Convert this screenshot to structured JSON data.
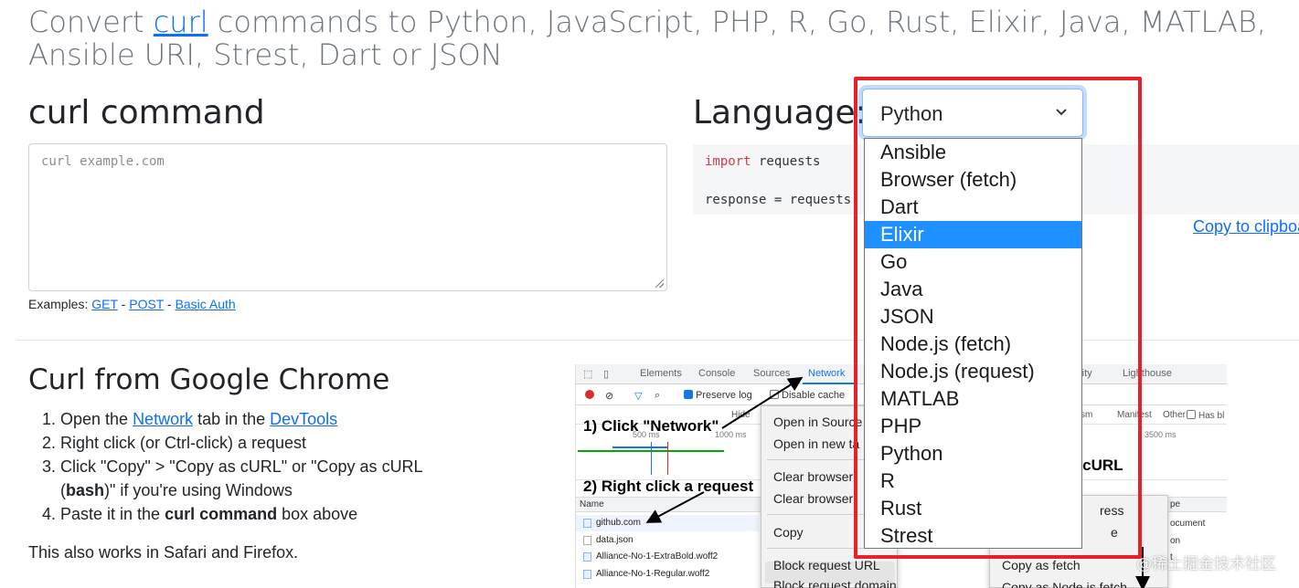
{
  "header": {
    "prefix": "Convert ",
    "link": "curl",
    "suffix": " commands to Python, JavaScript, PHP, R, Go, Rust, Elixir, Java, MATLAB, Ansible URI, Strest, Dart or JSON"
  },
  "curl_panel": {
    "title": "curl command",
    "placeholder": "curl example.com",
    "examples_label": "Examples: ",
    "examples": [
      "GET",
      "POST",
      "Basic Auth"
    ],
    "separator": " - "
  },
  "language_panel": {
    "title": "Language:",
    "selected": "Python",
    "options": [
      "Ansible",
      "Browser (fetch)",
      "Dart",
      "Elixir",
      "Go",
      "Java",
      "JSON",
      "Node.js (fetch)",
      "Node.js (request)",
      "MATLAB",
      "PHP",
      "Python",
      "R",
      "Rust",
      "Strest"
    ],
    "highlighted": "Elixir",
    "code_line1_kw": "import",
    "code_line1_rest": " requests",
    "code_line2": "response = requests.",
    "copy_label": "Copy to clipboard"
  },
  "chrome_section": {
    "title": "Curl from Google Chrome",
    "steps": [
      {
        "num": "1.",
        "a": "Open the ",
        "link1": "Network",
        "b": " tab in the ",
        "link2": "DevTools"
      },
      {
        "num": "2.",
        "text": "Right click (or Ctrl-click) a request"
      },
      {
        "num": "3.",
        "a": "Click \"Copy\" > \"Copy as cURL\" or \"Copy as cURL (",
        "bold": "bash",
        "b": ")\" if you're using Windows"
      },
      {
        "num": "4.",
        "a": "Paste it in the ",
        "bold": "curl command",
        "b": " box above"
      }
    ],
    "also": "This also works in Safari and Firefox."
  },
  "devtools_image": {
    "tabs": [
      "Elements",
      "Console",
      "Sources",
      "Network",
      "rity",
      "Lighthouse"
    ],
    "preserve_log": "Preserve log",
    "disable_cache": "Disable cache",
    "hide": "Hide",
    "filters_right": [
      "sm",
      "Manifest",
      "Other",
      "Has bl"
    ],
    "ticks": [
      "500 ms",
      "1000 ms",
      "3500 ms"
    ],
    "callout1": "1) Click \"Network\"",
    "callout2": "2) Right click a request",
    "callout3": "s cURL",
    "col_name": "Name",
    "col_type": "pe",
    "rows": [
      "github.com",
      "data.json",
      "Alliance-No-1-ExtraBold.woff2",
      "Alliance-No-1-Regular.woff2"
    ],
    "right_col": [
      "ocument",
      "on",
      "t"
    ],
    "menu": [
      "Open in Source",
      "Open in new ta",
      "Clear browser",
      "Clear browser",
      "Copy",
      "Block request URL",
      "Block request domain"
    ],
    "submenu": [
      "ress",
      "e",
      "Copy as fetch",
      "Copy as Node.js fetch"
    ]
  },
  "watermark": "@稀土掘金技术社区",
  "colors": {
    "link": "#0d6efd",
    "selected_option": "#1e90ff",
    "annotation_box": "#e8202a",
    "keyword": "#d73a49"
  }
}
